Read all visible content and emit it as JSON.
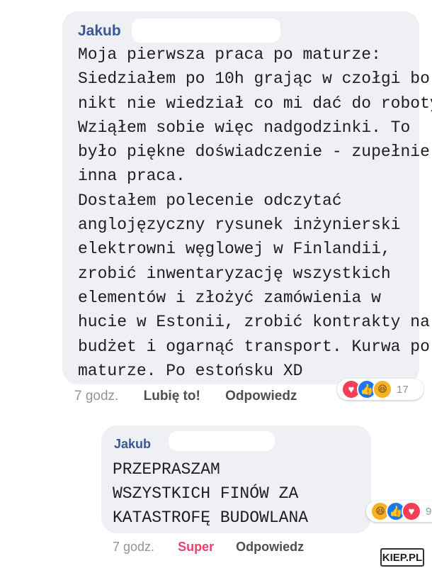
{
  "comment": {
    "author": "Jakub",
    "text_lines": [
      "Moja pierwsza praca po maturze:",
      "Siedziałem po 10h grając w czołgi bo",
      "nikt nie wiedział co mi dać do roboty.",
      "Wziąłem sobie więc nadgodzinki. To",
      "było piękne doświadczenie - zupełnie",
      "inna praca.",
      "Dostałem polecenie odczytać",
      "anglojęzyczny rysunek inżynierski",
      "elektrowni węglowej w Finlandii,",
      "zrobić inwentaryzację wszystkich",
      "elementów i złożyć zamówienia w",
      "hucie w Estonii, zrobić kontrakty na",
      "budżet i ogarnąć transport. Kurwa po",
      "maturze. Po estońsku XD"
    ],
    "time": "7 godz.",
    "like_label": "Lubię to!",
    "reply_label": "Odpowiedz",
    "reaction_count": "17",
    "reaction_icons": [
      "heart-icon",
      "like-icon",
      "haha-icon"
    ]
  },
  "reply": {
    "author": "Jakub",
    "text_lines": [
      "PRZEPRASZAM",
      "WSZYSTKICH FINÓW ZA",
      "KATASTROFĘ BUDOWLANA"
    ],
    "time": "7 godz.",
    "reaction_label": "Super",
    "reply_label": "Odpowiedz",
    "reaction_count": "9",
    "reaction_icons": [
      "haha-icon",
      "like-icon",
      "heart-icon"
    ]
  },
  "watermark": "KIEP.PL",
  "colors": {
    "bubble": "#eef0f3",
    "author": "#385898",
    "super": "#e9406e"
  }
}
